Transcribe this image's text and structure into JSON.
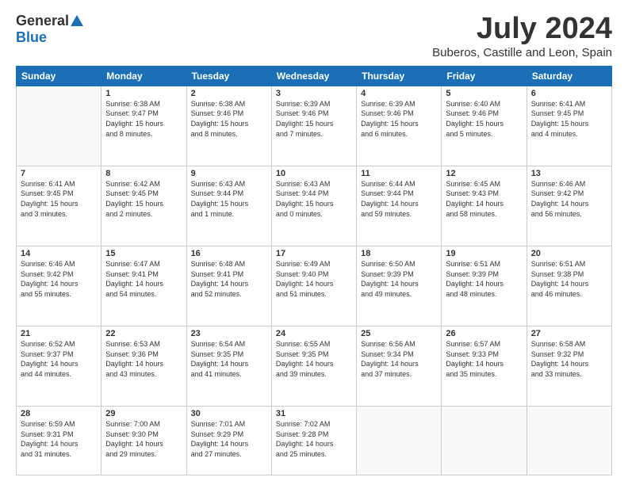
{
  "logo": {
    "general": "General",
    "blue": "Blue"
  },
  "header": {
    "month": "July 2024",
    "location": "Buberos, Castille and Leon, Spain"
  },
  "weekdays": [
    "Sunday",
    "Monday",
    "Tuesday",
    "Wednesday",
    "Thursday",
    "Friday",
    "Saturday"
  ],
  "weeks": [
    [
      {
        "day": "",
        "content": ""
      },
      {
        "day": "1",
        "content": "Sunrise: 6:38 AM\nSunset: 9:47 PM\nDaylight: 15 hours\nand 8 minutes."
      },
      {
        "day": "2",
        "content": "Sunrise: 6:38 AM\nSunset: 9:46 PM\nDaylight: 15 hours\nand 8 minutes."
      },
      {
        "day": "3",
        "content": "Sunrise: 6:39 AM\nSunset: 9:46 PM\nDaylight: 15 hours\nand 7 minutes."
      },
      {
        "day": "4",
        "content": "Sunrise: 6:39 AM\nSunset: 9:46 PM\nDaylight: 15 hours\nand 6 minutes."
      },
      {
        "day": "5",
        "content": "Sunrise: 6:40 AM\nSunset: 9:46 PM\nDaylight: 15 hours\nand 5 minutes."
      },
      {
        "day": "6",
        "content": "Sunrise: 6:41 AM\nSunset: 9:45 PM\nDaylight: 15 hours\nand 4 minutes."
      }
    ],
    [
      {
        "day": "7",
        "content": "Sunrise: 6:41 AM\nSunset: 9:45 PM\nDaylight: 15 hours\nand 3 minutes."
      },
      {
        "day": "8",
        "content": "Sunrise: 6:42 AM\nSunset: 9:45 PM\nDaylight: 15 hours\nand 2 minutes."
      },
      {
        "day": "9",
        "content": "Sunrise: 6:43 AM\nSunset: 9:44 PM\nDaylight: 15 hours\nand 1 minute."
      },
      {
        "day": "10",
        "content": "Sunrise: 6:43 AM\nSunset: 9:44 PM\nDaylight: 15 hours\nand 0 minutes."
      },
      {
        "day": "11",
        "content": "Sunrise: 6:44 AM\nSunset: 9:44 PM\nDaylight: 14 hours\nand 59 minutes."
      },
      {
        "day": "12",
        "content": "Sunrise: 6:45 AM\nSunset: 9:43 PM\nDaylight: 14 hours\nand 58 minutes."
      },
      {
        "day": "13",
        "content": "Sunrise: 6:46 AM\nSunset: 9:42 PM\nDaylight: 14 hours\nand 56 minutes."
      }
    ],
    [
      {
        "day": "14",
        "content": "Sunrise: 6:46 AM\nSunset: 9:42 PM\nDaylight: 14 hours\nand 55 minutes."
      },
      {
        "day": "15",
        "content": "Sunrise: 6:47 AM\nSunset: 9:41 PM\nDaylight: 14 hours\nand 54 minutes."
      },
      {
        "day": "16",
        "content": "Sunrise: 6:48 AM\nSunset: 9:41 PM\nDaylight: 14 hours\nand 52 minutes."
      },
      {
        "day": "17",
        "content": "Sunrise: 6:49 AM\nSunset: 9:40 PM\nDaylight: 14 hours\nand 51 minutes."
      },
      {
        "day": "18",
        "content": "Sunrise: 6:50 AM\nSunset: 9:39 PM\nDaylight: 14 hours\nand 49 minutes."
      },
      {
        "day": "19",
        "content": "Sunrise: 6:51 AM\nSunset: 9:39 PM\nDaylight: 14 hours\nand 48 minutes."
      },
      {
        "day": "20",
        "content": "Sunrise: 6:51 AM\nSunset: 9:38 PM\nDaylight: 14 hours\nand 46 minutes."
      }
    ],
    [
      {
        "day": "21",
        "content": "Sunrise: 6:52 AM\nSunset: 9:37 PM\nDaylight: 14 hours\nand 44 minutes."
      },
      {
        "day": "22",
        "content": "Sunrise: 6:53 AM\nSunset: 9:36 PM\nDaylight: 14 hours\nand 43 minutes."
      },
      {
        "day": "23",
        "content": "Sunrise: 6:54 AM\nSunset: 9:35 PM\nDaylight: 14 hours\nand 41 minutes."
      },
      {
        "day": "24",
        "content": "Sunrise: 6:55 AM\nSunset: 9:35 PM\nDaylight: 14 hours\nand 39 minutes."
      },
      {
        "day": "25",
        "content": "Sunrise: 6:56 AM\nSunset: 9:34 PM\nDaylight: 14 hours\nand 37 minutes."
      },
      {
        "day": "26",
        "content": "Sunrise: 6:57 AM\nSunset: 9:33 PM\nDaylight: 14 hours\nand 35 minutes."
      },
      {
        "day": "27",
        "content": "Sunrise: 6:58 AM\nSunset: 9:32 PM\nDaylight: 14 hours\nand 33 minutes."
      }
    ],
    [
      {
        "day": "28",
        "content": "Sunrise: 6:59 AM\nSunset: 9:31 PM\nDaylight: 14 hours\nand 31 minutes."
      },
      {
        "day": "29",
        "content": "Sunrise: 7:00 AM\nSunset: 9:30 PM\nDaylight: 14 hours\nand 29 minutes."
      },
      {
        "day": "30",
        "content": "Sunrise: 7:01 AM\nSunset: 9:29 PM\nDaylight: 14 hours\nand 27 minutes."
      },
      {
        "day": "31",
        "content": "Sunrise: 7:02 AM\nSunset: 9:28 PM\nDaylight: 14 hours\nand 25 minutes."
      },
      {
        "day": "",
        "content": ""
      },
      {
        "day": "",
        "content": ""
      },
      {
        "day": "",
        "content": ""
      }
    ]
  ]
}
